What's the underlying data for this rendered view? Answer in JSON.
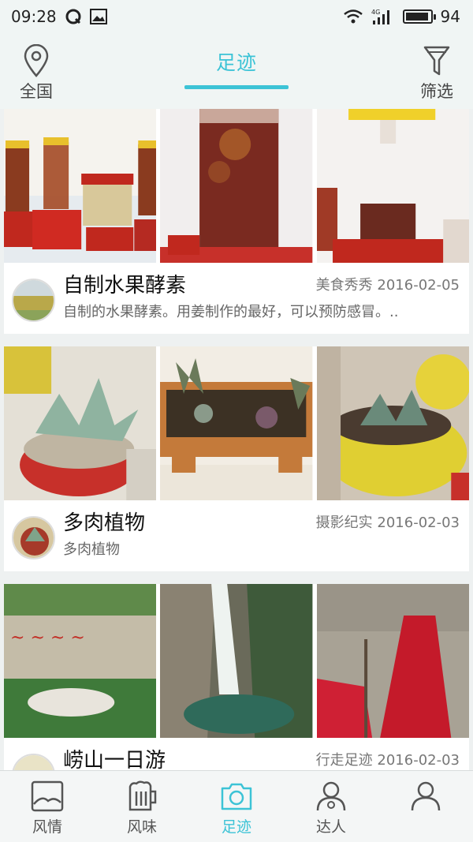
{
  "status_bar": {
    "time": "09:28",
    "network": "4G",
    "battery_level": "94",
    "battery_fraction": 0.94
  },
  "top_nav": {
    "left_label": "全国",
    "title": "足迹",
    "right_label": "筛选",
    "accent_color": "#3cc3d6"
  },
  "feed": [
    {
      "title": "自制水果酵素",
      "category": "美食秀秀",
      "date": "2016-02-05",
      "description": "自制的水果酵素。用姜制作的最好，可以预防感冒。.."
    },
    {
      "title": "多肉植物",
      "category": "摄影纪实",
      "date": "2016-02-03",
      "description": "多肉植物"
    },
    {
      "title": "崂山一日游",
      "category": "行走足迹",
      "date": "2016-02-03",
      "description": ""
    }
  ],
  "tab_bar": {
    "tabs": [
      {
        "label": "风情",
        "icon": "picture-icon"
      },
      {
        "label": "风味",
        "icon": "beer-mug-icon"
      },
      {
        "label": "足迹",
        "icon": "camera-icon"
      },
      {
        "label": "达人",
        "icon": "expert-person-icon"
      },
      {
        "label": "",
        "icon": "person-icon"
      }
    ],
    "active_index": 2
  }
}
